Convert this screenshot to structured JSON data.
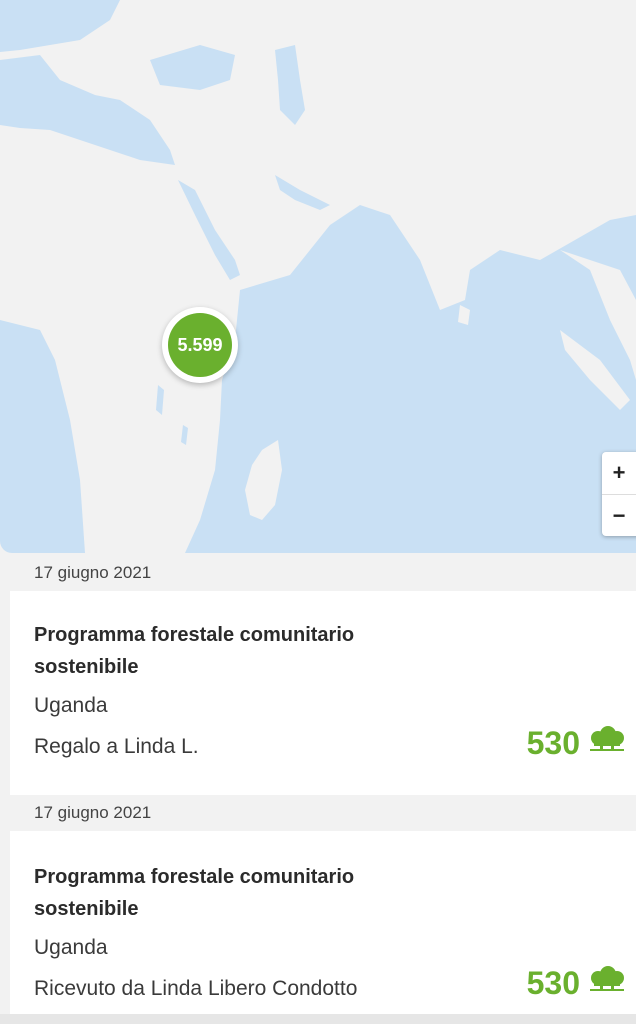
{
  "map": {
    "cluster_count": "5.599",
    "zoom_in_label": "+",
    "zoom_out_label": "−",
    "colors": {
      "water": "#c9e0f4",
      "land": "#f2f2f2",
      "cluster": "#6ab02e"
    }
  },
  "entries": [
    {
      "date": "17 giugno 2021",
      "title": "Programma forestale comunitario sostenibile",
      "country": "Uganda",
      "detail": "Regalo a Linda L.",
      "amount": "530",
      "icon": "trees-icon"
    },
    {
      "date": "17 giugno 2021",
      "title": "Programma forestale comunitario sostenibile",
      "country": "Uganda",
      "detail": "Ricevuto da Linda Libero Condotto",
      "amount": "530",
      "icon": "trees-icon"
    }
  ]
}
